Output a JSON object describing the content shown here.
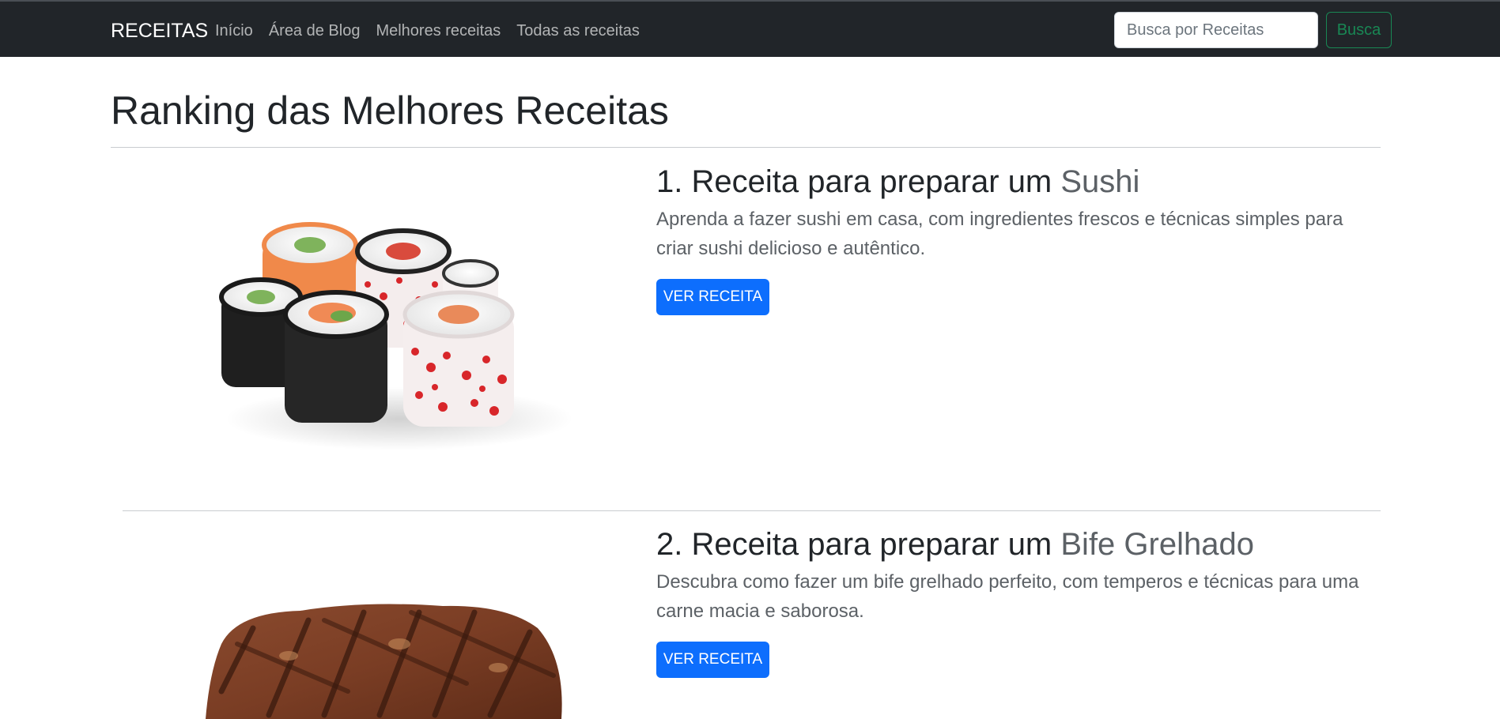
{
  "navbar": {
    "brand": "RECEITAS",
    "links": [
      "Início",
      "Área de Blog",
      "Melhores receitas",
      "Todas as receitas"
    ],
    "search_placeholder": "Busca por Receitas",
    "search_button": "Busca"
  },
  "page": {
    "title": "Ranking das Melhores Receitas"
  },
  "recipes": [
    {
      "prefix": "1. Receita para preparar um ",
      "name": "Sushi",
      "description": "Aprenda a fazer sushi em casa, com ingredientes frescos e técnicas simples para criar sushi delicioso e autêntico.",
      "button": "VER RECEITA",
      "image": "sushi-photo"
    },
    {
      "prefix": "2. Receita para preparar um ",
      "name": "Bife Grelhado",
      "description": "Descubra como fazer um bife grelhado perfeito, com temperos e técnicas para uma carne macia e saborosa.",
      "button": "VER RECEITA",
      "image": "steak-photo"
    }
  ],
  "colors": {
    "navbar_bg": "#212529",
    "primary": "#0d6efd",
    "success": "#198754"
  }
}
